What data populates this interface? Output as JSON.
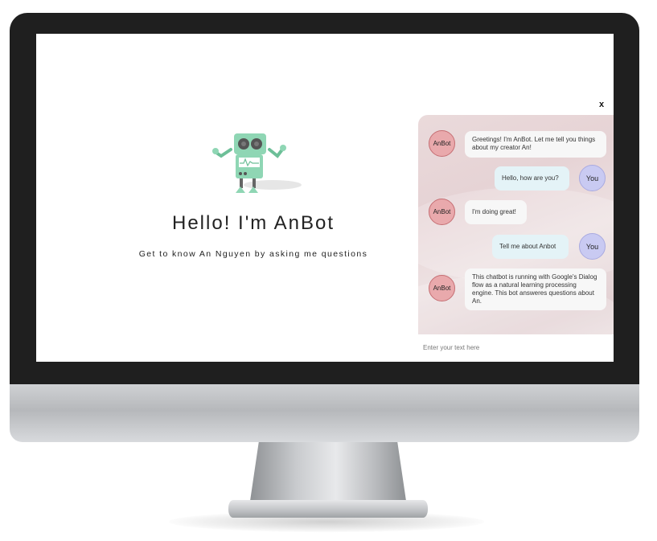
{
  "hero": {
    "title": "Hello! I'm AnBot",
    "subtitle": "Get to know An Nguyen by asking me questions"
  },
  "chat": {
    "close_label": "x",
    "messages": [
      {
        "sender": "bot",
        "avatar": "AnBot",
        "text": "Greetings! I'm AnBot. Let me tell you things about my creator An!"
      },
      {
        "sender": "user",
        "avatar": "You",
        "text": "Hello, how are you?"
      },
      {
        "sender": "bot",
        "avatar": "AnBot",
        "text": "I'm doing great!"
      },
      {
        "sender": "user",
        "avatar": "You",
        "text": "Tell me about Anbot"
      },
      {
        "sender": "bot",
        "avatar": "AnBot",
        "text": "This chatbot is running with Google's Dialog flow as a natural learning processing engine. This bot answeres questions about An."
      }
    ],
    "input": {
      "placeholder": "Enter your text here",
      "value": ""
    }
  },
  "icons": {
    "robot": "robot-mascot-icon"
  },
  "colors": {
    "robot_green": "#8fd6b4",
    "bot_avatar": "#e9a9ac",
    "user_avatar": "#c9caf2",
    "user_bubble": "#e4f3f7",
    "chat_bg": "#eadadb"
  }
}
